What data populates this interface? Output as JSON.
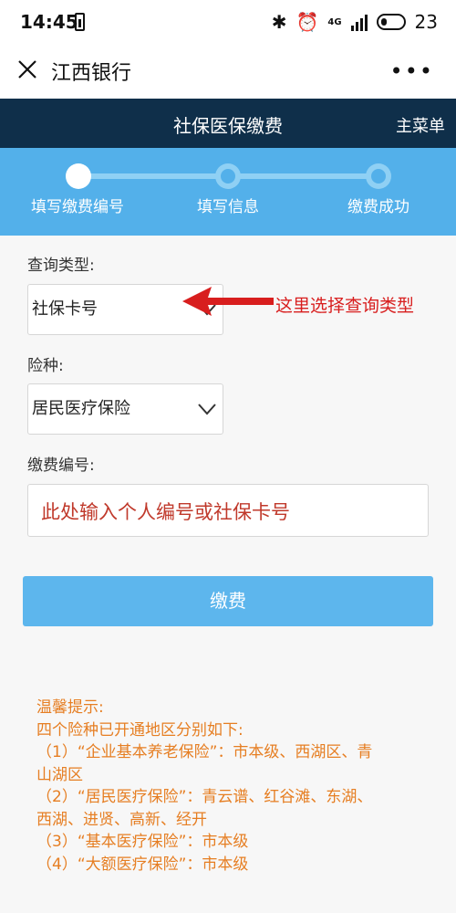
{
  "status_bar": {
    "time": "14:45",
    "network": "4G",
    "battery_level": "23"
  },
  "app_bar": {
    "title": "江西银行"
  },
  "header": {
    "title": "社保医保缴费",
    "menu_label": "主菜单"
  },
  "steps": [
    {
      "label": "填写缴费编号",
      "state": "active"
    },
    {
      "label": "填写信息",
      "state": "inactive"
    },
    {
      "label": "缴费成功",
      "state": "inactive"
    }
  ],
  "form": {
    "query_type_label": "查询类型:",
    "query_type_value": "社保卡号",
    "insurance_label": "险种:",
    "insurance_value": "居民医疗保险",
    "payment_no_label": "缴费编号:",
    "payment_no_placeholder": "此处输入个人编号或社保卡号",
    "pay_button": "缴费"
  },
  "annotation": {
    "text": "这里选择查询类型",
    "color": "#d81e1e"
  },
  "tips": {
    "lines": [
      "温馨提示:",
      "四个险种已开通地区分别如下:",
      "（1）“企业基本养老保险”：市本级、西湖区、青",
      "山湖区",
      "（2）“居民医疗保险”：青云谱、红谷滩、东湖、",
      "西湖、进贤、高新、经开",
      "（3）“基本医疗保险”：市本级",
      "（4）“大额医疗保险”：市本级"
    ],
    "color": "#e67e22"
  },
  "colors": {
    "header_bg": "#0f2f4a",
    "steps_bg": "#53b0ea",
    "button_bg": "#5db6ed"
  }
}
